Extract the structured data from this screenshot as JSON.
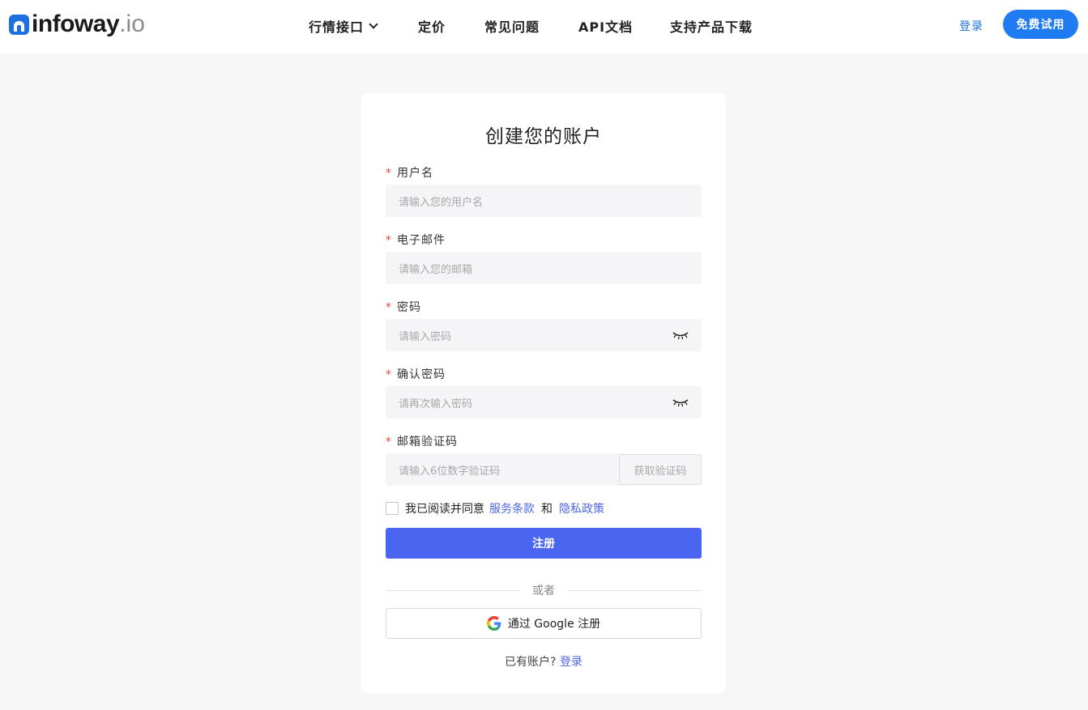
{
  "header": {
    "logo_main": "infoway",
    "logo_suffix": ".io",
    "nav": [
      {
        "label": "行情接口",
        "has_dropdown": true
      },
      {
        "label": "定价"
      },
      {
        "label": "常见问题"
      },
      {
        "label": "API文档"
      },
      {
        "label": "支持产品下载"
      }
    ],
    "login_label": "登录",
    "trial_label": "免费试用"
  },
  "form": {
    "title": "创建您的账户",
    "fields": [
      {
        "label": "用户名",
        "required_mark": "*",
        "placeholder": "请输入您的用户名"
      },
      {
        "label": "电子邮件",
        "required_mark": "*",
        "placeholder": "请输入您的邮箱"
      },
      {
        "label": "密码",
        "required_mark": "*",
        "placeholder": "请输入密码",
        "icon": "eye-closed-icon"
      },
      {
        "label": "确认密码",
        "required_mark": "*",
        "placeholder": "请再次输入密码",
        "icon": "eye-closed-icon"
      },
      {
        "label": "邮箱验证码",
        "required_mark": "*",
        "placeholder": "请输入6位数字验证码"
      }
    ],
    "get_code_label": "获取验证码",
    "agree_text": "我已阅读并同意",
    "terms_label": "服务条款",
    "and_text": "和",
    "privacy_label": "隐私政策",
    "submit_label": "注册",
    "divider_text": "或者",
    "google_label": "通过 Google 注册",
    "have_account_text": "已有账户?",
    "login_link_label": "登录"
  },
  "colors": {
    "brand_blue": "#1e7bf0",
    "submit_blue": "#4a66f0",
    "link_blue": "#4d65e6",
    "required_red": "#e54545"
  }
}
